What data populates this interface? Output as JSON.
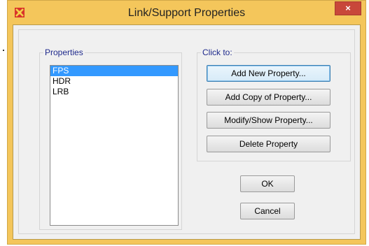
{
  "window": {
    "title": "Link/Support Properties",
    "close_label": "×"
  },
  "properties_group": {
    "label": "Properties",
    "items": [
      {
        "label": "FPS",
        "selected": true
      },
      {
        "label": "HDR",
        "selected": false
      },
      {
        "label": "LRB",
        "selected": false
      }
    ]
  },
  "actions_group": {
    "label": "Click to:",
    "add_new_label": "Add New Property...",
    "add_copy_label": "Add Copy of Property...",
    "modify_label": "Modify/Show Property...",
    "delete_label": "Delete Property"
  },
  "ok_label": "OK",
  "cancel_label": "Cancel",
  "colors": {
    "title_bar": "#f4c65b",
    "close_button": "#c8473a",
    "selection": "#3399ff",
    "group_label": "#1f2a8c"
  },
  "icons": {
    "app": "app-logo-icon",
    "close": "close-icon"
  }
}
